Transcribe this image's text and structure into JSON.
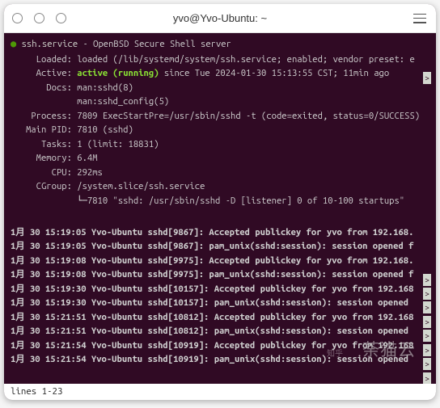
{
  "titlebar": {
    "title": "yvo@Yvo-Ubuntu: ~"
  },
  "service": {
    "name": "ssh.service",
    "desc": "OpenBSD Secure Shell server",
    "loaded": "Loaded: loaded (/lib/systemd/system/ssh.service; enabled; vendor preset: e",
    "active_label": "Active: ",
    "active_state": "active",
    "active_running": " (running)",
    "active_since": " since Tue 2024-01-30 15:13:55 CST; 11min ago",
    "docs1": "Docs: man:sshd(8)",
    "docs2": "man:sshd_config(5)",
    "process": "Process: 7809 ExecStartPre=/usr/sbin/sshd -t (code=exited, status=0/SUCCESS)",
    "mainpid": "Main PID: 7810 (sshd)",
    "tasks": "Tasks: 1 (limit: 18831)",
    "memory": "Memory: 6.4M",
    "cpu": "CPU: 292ms",
    "cgroup": "CGroup: /system.slice/ssh.service",
    "cgroup2": "└─7810 \"sshd: /usr/sbin/sshd -D [listener] 0 of 10-100 startups\""
  },
  "logs": [
    "1月 30 15:19:05 Yvo-Ubuntu sshd[9867]: Accepted publickey for yvo from 192.168.",
    "1月 30 15:19:05 Yvo-Ubuntu sshd[9867]: pam_unix(sshd:session): session opened f",
    "1月 30 15:19:08 Yvo-Ubuntu sshd[9975]: Accepted publickey for yvo from 192.168.",
    "1月 30 15:19:08 Yvo-Ubuntu sshd[9975]: pam_unix(sshd:session): session opened f",
    "1月 30 15:19:30 Yvo-Ubuntu sshd[10157]: Accepted publickey for yvo from 192.168",
    "1月 30 15:19:30 Yvo-Ubuntu sshd[10157]: pam_unix(sshd:session): session opened ",
    "1月 30 15:21:51 Yvo-Ubuntu sshd[10812]: Accepted publickey for yvo from 192.168",
    "1月 30 15:21:51 Yvo-Ubuntu sshd[10812]: pam_unix(sshd:session): session opened ",
    "1月 30 15:21:54 Yvo-Ubuntu sshd[10919]: Accepted publickey for yvo from 192.168",
    "1月 30 15:21:54 Yvo-Ubuntu sshd[10919]: pam_unix(sshd:session): session opened "
  ],
  "statusbar": "lines 1-23",
  "watermark": {
    "small": "知乎",
    "large": "荼猫云"
  }
}
